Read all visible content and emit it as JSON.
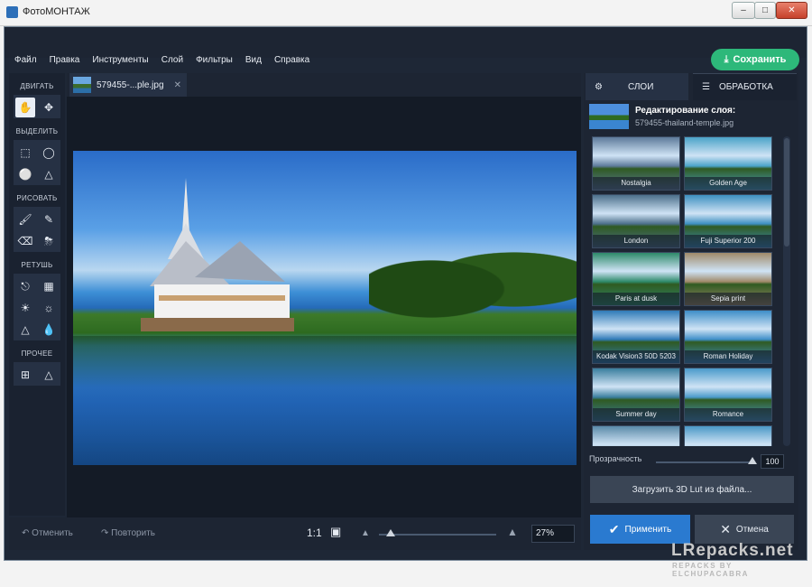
{
  "window": {
    "title": "ФотоМОНТАЖ"
  },
  "menu": [
    "Файл",
    "Правка",
    "Инструменты",
    "Слой",
    "Фильтры",
    "Вид",
    "Справка"
  ],
  "toolbar": {
    "save_label": "Сохранить"
  },
  "tools": {
    "sections": [
      "ДВИГАТЬ",
      "ВЫДЕЛИТЬ",
      "РИСОВАТЬ",
      "РЕТУШЬ",
      "ПРОЧЕЕ"
    ]
  },
  "document_tab": {
    "label": "579455-...ple.jpg"
  },
  "bottom": {
    "undo": "Отменить",
    "redo": "Повторить",
    "ratio": "1:1",
    "zoom": "27%",
    "zoom_level": 0.09
  },
  "right_tabs": {
    "layers": "СЛОИ",
    "processing": "ОБРАБОТКА"
  },
  "layer_info": {
    "title": "Редактирование слоя:",
    "file": "579455-thailand-temple.jpg"
  },
  "presets": [
    {
      "name": "Nostalgia",
      "tint": "#5d7a9a"
    },
    {
      "name": "Golden Age",
      "tint": "#4aa3c8"
    },
    {
      "name": "London",
      "tint": "#4c6f8a"
    },
    {
      "name": "Fuji Superior 200",
      "tint": "#3d8fc0"
    },
    {
      "name": "Paris at dusk",
      "tint": "#2e8a6a"
    },
    {
      "name": "Sepia print",
      "tint": "#a08a6a"
    },
    {
      "name": "Kodak Vision3 50D 5203",
      "tint": "#2f7ab8"
    },
    {
      "name": "Roman Holiday",
      "tint": "#3e8ec8"
    },
    {
      "name": "Summer day",
      "tint": "#3a7e9e"
    },
    {
      "name": "Romance",
      "tint": "#4a9aca"
    },
    {
      "name": "",
      "tint": "#5a8aa8"
    },
    {
      "name": "",
      "tint": "#4a98c6"
    }
  ],
  "opacity": {
    "label": "Прозрачность",
    "value": "100"
  },
  "buttons": {
    "load_lut": "Загрузить 3D Lut из файла...",
    "apply": "Применить",
    "cancel": "Отмена"
  },
  "watermark": {
    "main": "LRepacks.net",
    "sub": "REPACKS BY ELCHUPACABRA"
  }
}
